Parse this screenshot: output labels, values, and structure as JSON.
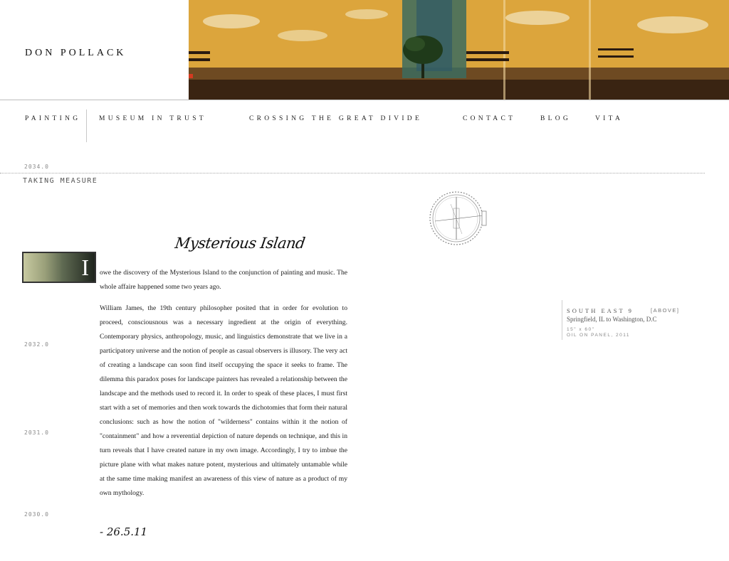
{
  "site": {
    "title": "DON POLLACK"
  },
  "nav": {
    "items": [
      {
        "label": "PAINTING"
      },
      {
        "label": "MUSEUM IN TRUST"
      },
      {
        "label": "CROSSING THE GREAT DIVIDE"
      },
      {
        "label": "CONTACT"
      },
      {
        "label": "BLOG"
      },
      {
        "label": "VITA"
      }
    ]
  },
  "timeline": {
    "years": [
      "2034.0",
      "2032.0",
      "2031.0",
      "2030.0"
    ]
  },
  "section": {
    "label": "TAKING MEASURE"
  },
  "article": {
    "title": "Mysterious Island",
    "dropcap": "I",
    "intro": "owe the discovery of the Mysterious Island to the conjunction of painting and music. The whole affaire happened some two years ago.",
    "paragraph": "William James, the 19th century philosopher posited that in order for evolution to proceed, consciousnous was a necessary ingredient at the origin of everything. Contemporary physics, anthropology, music, and linguistics demonstrate that we live in a participatory universe and the notion of people as casual observers is illusory. The very act of creating a landscape can soon find itself occupying the space it seeks to frame. The dilemma this paradox poses for landscape painters has revealed a relationship between the landscape and the methods used to record it. In order to speak of these places, I must first start with a set of memories and then work towards the dichotomies that form their natural conclusions: such as how the notion of \"wilderness\" contains within it the notion of \"containment\" and how a reverential depiction of nature depends on technique, and this in turn reveals that I have created nature in my own image. Accordingly, I try to imbue the picture plane with what makes nature potent, mysterious and ultimately untamable while at the same time making manifest an awareness of this view of nature as a product of my own mythology.",
    "signature": "- 26.5.11"
  },
  "caption": {
    "title": "SOUTH EAST 9",
    "tag": "[ABOVE]",
    "place": "Springfield, IL to Washington, D.C",
    "size": "15\" x 60\"",
    "medium": "OIL ON PANEL, 2011"
  },
  "colors": {
    "banner_gold": "#e0a63a",
    "banner_dark": "#3a2412",
    "rule": "#bdbdbd"
  },
  "icons": {
    "compass": "compass-icon"
  }
}
